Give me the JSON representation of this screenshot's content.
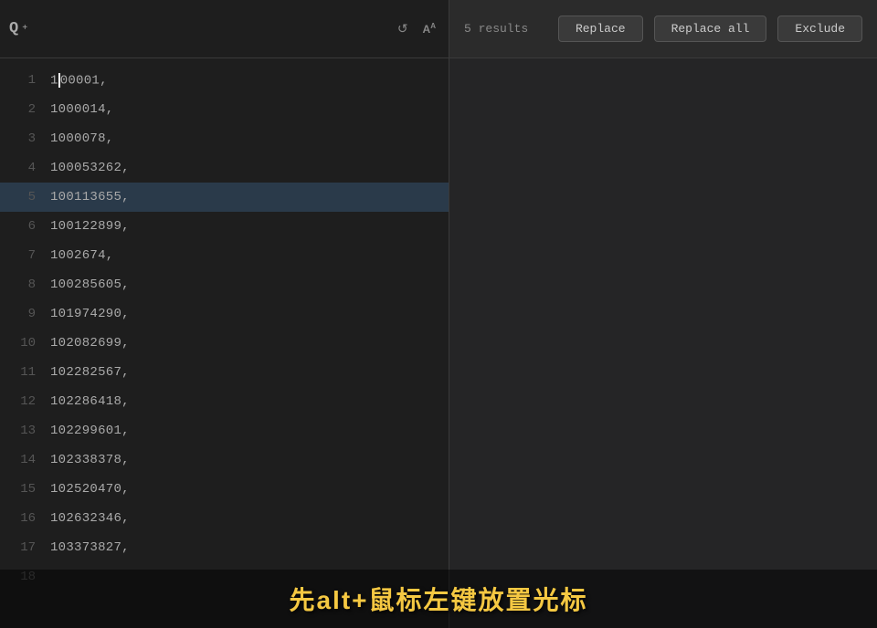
{
  "toolbar": {
    "search_placeholder": "",
    "results_label": "5 results",
    "replace_label": "Replace",
    "replace_all_label": "Replace all",
    "exclude_label": "Exclude"
  },
  "editor": {
    "lines": [
      {
        "number": 1,
        "content": "100001,",
        "highlighted": false
      },
      {
        "number": 2,
        "content": "1000014,",
        "highlighted": false
      },
      {
        "number": 3,
        "content": "1000078,",
        "highlighted": false
      },
      {
        "number": 4,
        "content": "100053262,",
        "highlighted": false
      },
      {
        "number": 5,
        "content": "100113655,",
        "highlighted": true
      },
      {
        "number": 6,
        "content": "100122899,",
        "highlighted": false
      },
      {
        "number": 7,
        "content": "1002674,",
        "highlighted": false
      },
      {
        "number": 8,
        "content": "100285605,",
        "highlighted": false
      },
      {
        "number": 9,
        "content": "101974290,",
        "highlighted": false
      },
      {
        "number": 10,
        "content": "102082699,",
        "highlighted": false
      },
      {
        "number": 11,
        "content": "102282567,",
        "highlighted": false
      },
      {
        "number": 12,
        "content": "102286418,",
        "highlighted": false
      },
      {
        "number": 13,
        "content": "102299601,",
        "highlighted": false
      },
      {
        "number": 14,
        "content": "102338378,",
        "highlighted": false
      },
      {
        "number": 15,
        "content": "102520470,",
        "highlighted": false
      },
      {
        "number": 16,
        "content": "102632346,",
        "highlighted": false
      },
      {
        "number": 17,
        "content": "103373827,",
        "highlighted": false
      },
      {
        "number": 18,
        "content": "",
        "highlighted": false
      }
    ]
  },
  "subtitle": {
    "text": "先alt+鼠标左键放置光标"
  },
  "icons": {
    "search": "Q",
    "regex": ".*",
    "case": "AA",
    "arrow": "↺"
  }
}
